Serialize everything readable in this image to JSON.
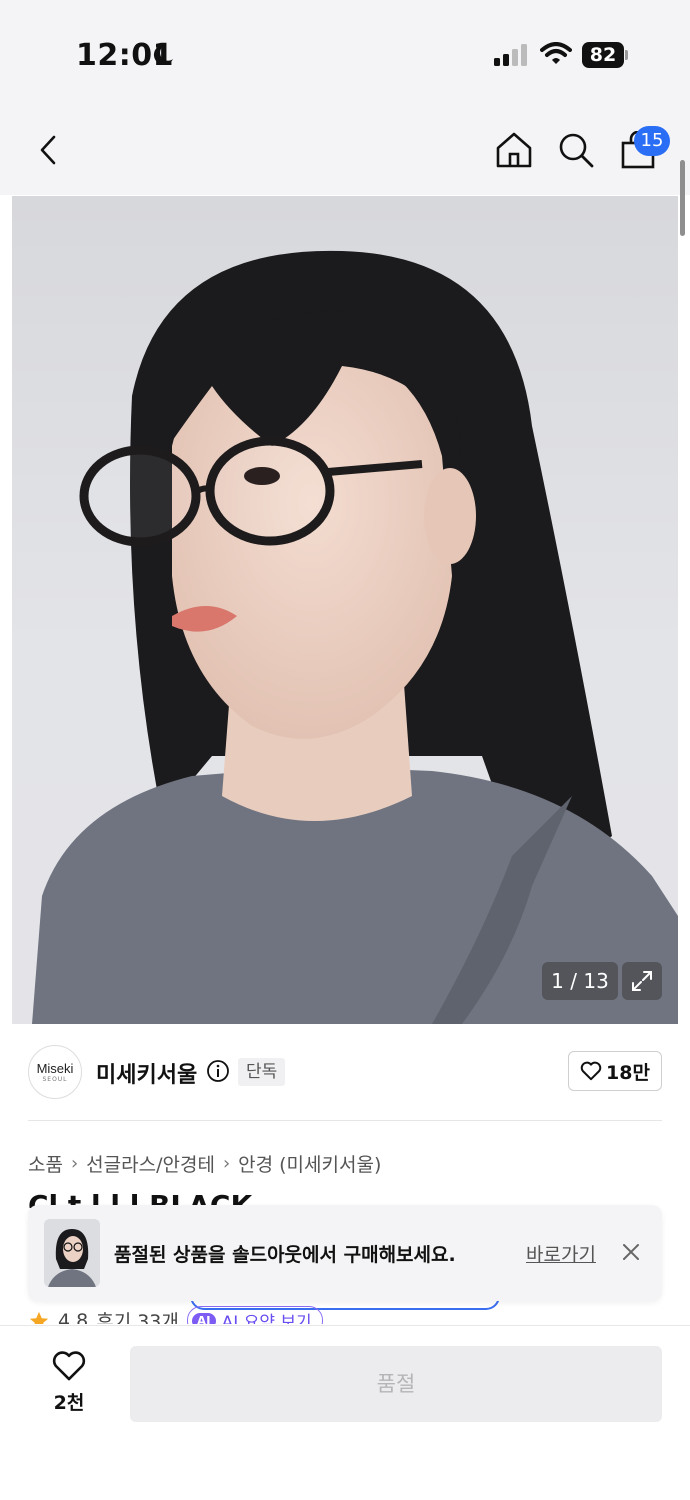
{
  "status_bar": {
    "time": "12:01",
    "battery": "82"
  },
  "nav": {
    "cart_count": "15"
  },
  "gallery": {
    "counter": "1 / 13"
  },
  "brand": {
    "logo_main": "Miseki",
    "logo_sub": "SEOUL",
    "name": "미세키서울",
    "badge": "단독",
    "likes": "18만"
  },
  "breadcrumb": [
    "소품",
    "선글라스/안경테",
    "안경 (미세키서울)"
  ],
  "product": {
    "title_partial": "Cl         t  l              l l       BLACK",
    "rating": "4.8",
    "reviews": "후기 33개",
    "ai_summary": "AI 요약 보기",
    "ai_badge": "AI"
  },
  "toast": {
    "message": "품절된 상품을 솔드아웃에서 구매해보세요.",
    "link": "바로가기"
  },
  "bottom": {
    "wish_count": "2천",
    "buy_label": "품절"
  },
  "colors": {
    "accent_blue": "#2a6ef5",
    "ai_purple": "#7c5cf2",
    "star": "#f5a623"
  }
}
